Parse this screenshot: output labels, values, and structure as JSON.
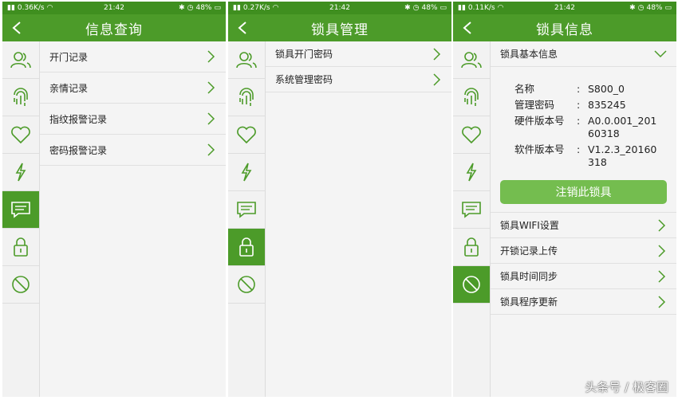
{
  "statusbars": [
    {
      "signal": "0.36K/s",
      "time": "21:42",
      "battery": "48%"
    },
    {
      "signal": "0.27K/s",
      "time": "21:42",
      "battery": "48%"
    },
    {
      "signal": "0.11K/s",
      "time": "21:42",
      "battery": "48%"
    }
  ],
  "panel1": {
    "title": "信息查询",
    "rows": [
      "开门记录",
      "亲情记录",
      "指纹报警记录",
      "密码报警记录"
    ]
  },
  "panel2": {
    "title": "锁具管理",
    "rows": [
      "锁具开门密码",
      "系统管理密码"
    ]
  },
  "panel3": {
    "title": "锁具信息",
    "section_header": "锁具基本信息",
    "info": [
      {
        "key": "名称",
        "colon": ":",
        "value": "S800_0"
      },
      {
        "key": "管理密码",
        "colon": ":",
        "value": "835245"
      },
      {
        "key": "硬件版本号",
        "colon": ":",
        "value": "A0.0.001_20160318"
      },
      {
        "key": "软件版本号",
        "colon": ":",
        "value": "V1.2.3_20160318"
      }
    ],
    "button": "注销此锁具",
    "rows": [
      "锁具WIFI设置",
      "开锁记录上传",
      "锁具时间同步",
      "锁具程序更新"
    ]
  },
  "watermark": "头条号 / 极客圈",
  "colors": {
    "accent": "#4c9b29",
    "button": "#74bd4f",
    "icon": "#4c9b29"
  }
}
